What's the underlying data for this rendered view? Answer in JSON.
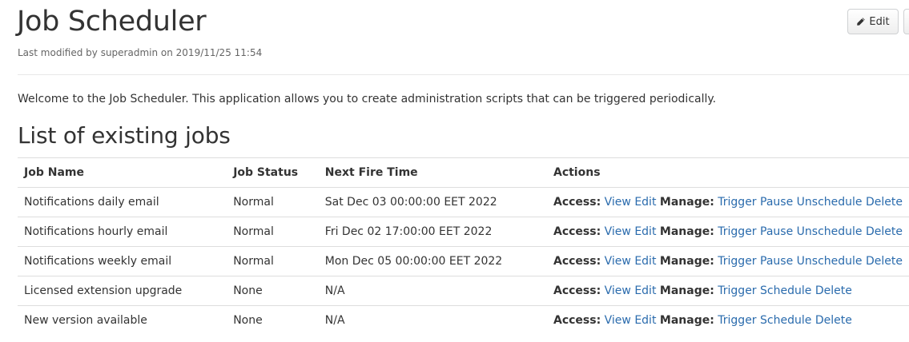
{
  "document": {
    "title": "Job Scheduler",
    "modified_text": "Last modified by superadmin on 2019/11/25 11:54",
    "edit_label": "Edit",
    "intro": "Welcome to the Job Scheduler. This application allows you to create administration scripts that can be triggered periodically.",
    "section_title": "List of existing jobs"
  },
  "table": {
    "headers": [
      "Job Name",
      "Job Status",
      "Next Fire Time",
      "Actions"
    ],
    "access_label": "Access:",
    "manage_label": "Manage:",
    "rows": [
      {
        "name": "Notifications daily email",
        "status": "Normal",
        "next_fire": "Sat Dec 03 00:00:00 EET 2022",
        "access": [
          "View",
          "Edit"
        ],
        "manage": [
          "Trigger",
          "Pause",
          "Unschedule",
          "Delete"
        ]
      },
      {
        "name": "Notifications hourly email",
        "status": "Normal",
        "next_fire": "Fri Dec 02 17:00:00 EET 2022",
        "access": [
          "View",
          "Edit"
        ],
        "manage": [
          "Trigger",
          "Pause",
          "Unschedule",
          "Delete"
        ]
      },
      {
        "name": "Notifications weekly email",
        "status": "Normal",
        "next_fire": "Mon Dec 05 00:00:00 EET 2022",
        "access": [
          "View",
          "Edit"
        ],
        "manage": [
          "Trigger",
          "Pause",
          "Unschedule",
          "Delete"
        ]
      },
      {
        "name": "Licensed extension upgrade",
        "status": "None",
        "next_fire": "N/A",
        "access": [
          "View",
          "Edit"
        ],
        "manage": [
          "Trigger",
          "Schedule",
          "Delete"
        ]
      },
      {
        "name": "New version available",
        "status": "None",
        "next_fire": "N/A",
        "access": [
          "View",
          "Edit"
        ],
        "manage": [
          "Trigger",
          "Schedule",
          "Delete"
        ]
      }
    ]
  },
  "colors": {
    "link": "#2a6bad",
    "text": "#333333",
    "muted": "#656565",
    "border": "#dddddd"
  },
  "icons": {
    "edit_button": "pencil-icon"
  }
}
